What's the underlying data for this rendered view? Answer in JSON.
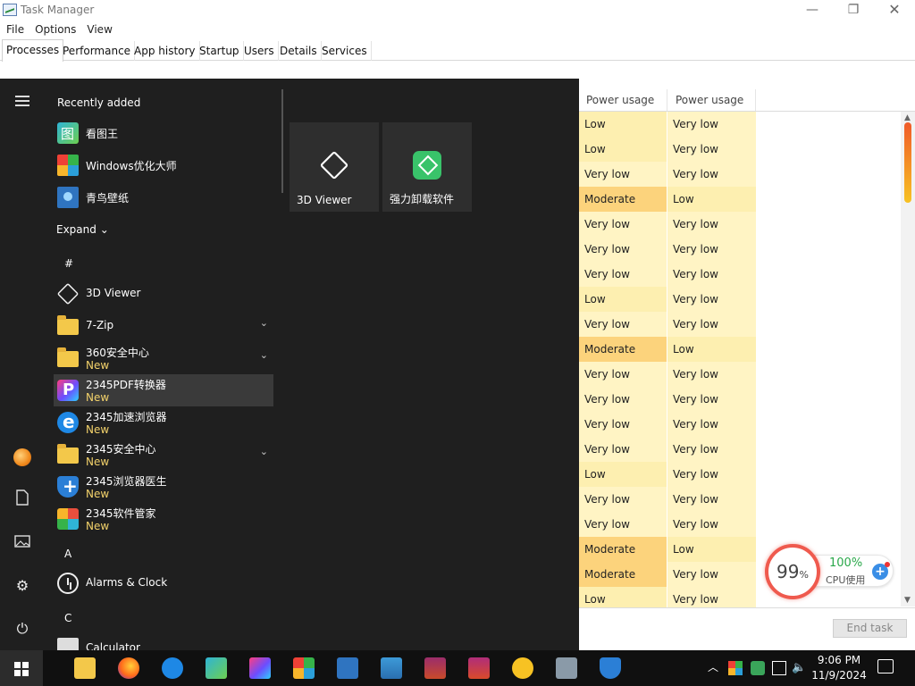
{
  "task_manager": {
    "title": "Task Manager",
    "menu": [
      "File",
      "Options",
      "View"
    ],
    "tabs": [
      "Processes",
      "Performance",
      "App history",
      "Startup",
      "Users",
      "Details",
      "Services"
    ],
    "active_tab": "Processes",
    "columns": [
      "Power usage",
      "Power usage t..."
    ],
    "rows": [
      [
        "Low",
        "Very low"
      ],
      [
        "Low",
        "Very low"
      ],
      [
        "Very low",
        "Very low"
      ],
      [
        "Moderate",
        "Low"
      ],
      [
        "Very low",
        "Very low"
      ],
      [
        "Very low",
        "Very low"
      ],
      [
        "Very low",
        "Very low"
      ],
      [
        "Low",
        "Very low"
      ],
      [
        "Very low",
        "Very low"
      ],
      [
        "Moderate",
        "Low"
      ],
      [
        "Very low",
        "Very low"
      ],
      [
        "Very low",
        "Very low"
      ],
      [
        "Very low",
        "Very low"
      ],
      [
        "Very low",
        "Very low"
      ],
      [
        "Low",
        "Very low"
      ],
      [
        "Very low",
        "Very low"
      ],
      [
        "Very low",
        "Very low"
      ],
      [
        "Moderate",
        "Low"
      ],
      [
        "Moderate",
        "Very low"
      ],
      [
        "Low",
        "Very low"
      ]
    ],
    "end_task_label": "End task"
  },
  "cpu_widget": {
    "ring_value": "99",
    "ring_unit": "%",
    "cpu_percent": "100%",
    "cpu_label": "CPU使用"
  },
  "start_menu": {
    "recently_added_label": "Recently added",
    "recent": [
      {
        "name": "看图王",
        "icon": "picture-viewer-icon"
      },
      {
        "name": "Windows优化大师",
        "icon": "windows-optimizer-icon"
      },
      {
        "name": "青鸟壁纸",
        "icon": "wallpaper-icon"
      }
    ],
    "expand_label": "Expand",
    "hash_label": "#",
    "apps": [
      {
        "name": "3D Viewer",
        "icon": "cube-icon",
        "sub": "",
        "chevron": false
      },
      {
        "name": "7-Zip",
        "icon": "folder-icon",
        "sub": "",
        "chevron": true
      },
      {
        "name": "360安全中心",
        "icon": "folder-icon",
        "sub": "New",
        "chevron": true
      },
      {
        "name": "2345PDF转换器",
        "icon": "pdf-converter-icon",
        "sub": "New",
        "chevron": false
      },
      {
        "name": "2345加速浏览器",
        "icon": "ie-browser-icon",
        "sub": "New",
        "chevron": false
      },
      {
        "name": "2345安全中心",
        "icon": "folder-icon",
        "sub": "New",
        "chevron": true
      },
      {
        "name": "2345浏览器医生",
        "icon": "shield-icon",
        "sub": "New",
        "chevron": false
      },
      {
        "name": "2345软件管家",
        "icon": "app-grid-icon",
        "sub": "New",
        "chevron": false
      }
    ],
    "letter_a": "A",
    "alarms_label": "Alarms & Clock",
    "letter_c": "C",
    "calculator_label": "Calculator",
    "tiles": [
      {
        "name": "3D Viewer",
        "icon": "cube-icon"
      },
      {
        "name": "强力卸载软件",
        "icon": "uninstaller-icon"
      }
    ]
  },
  "taskbar": {
    "time": "9:06 PM",
    "date": "11/9/2024"
  }
}
